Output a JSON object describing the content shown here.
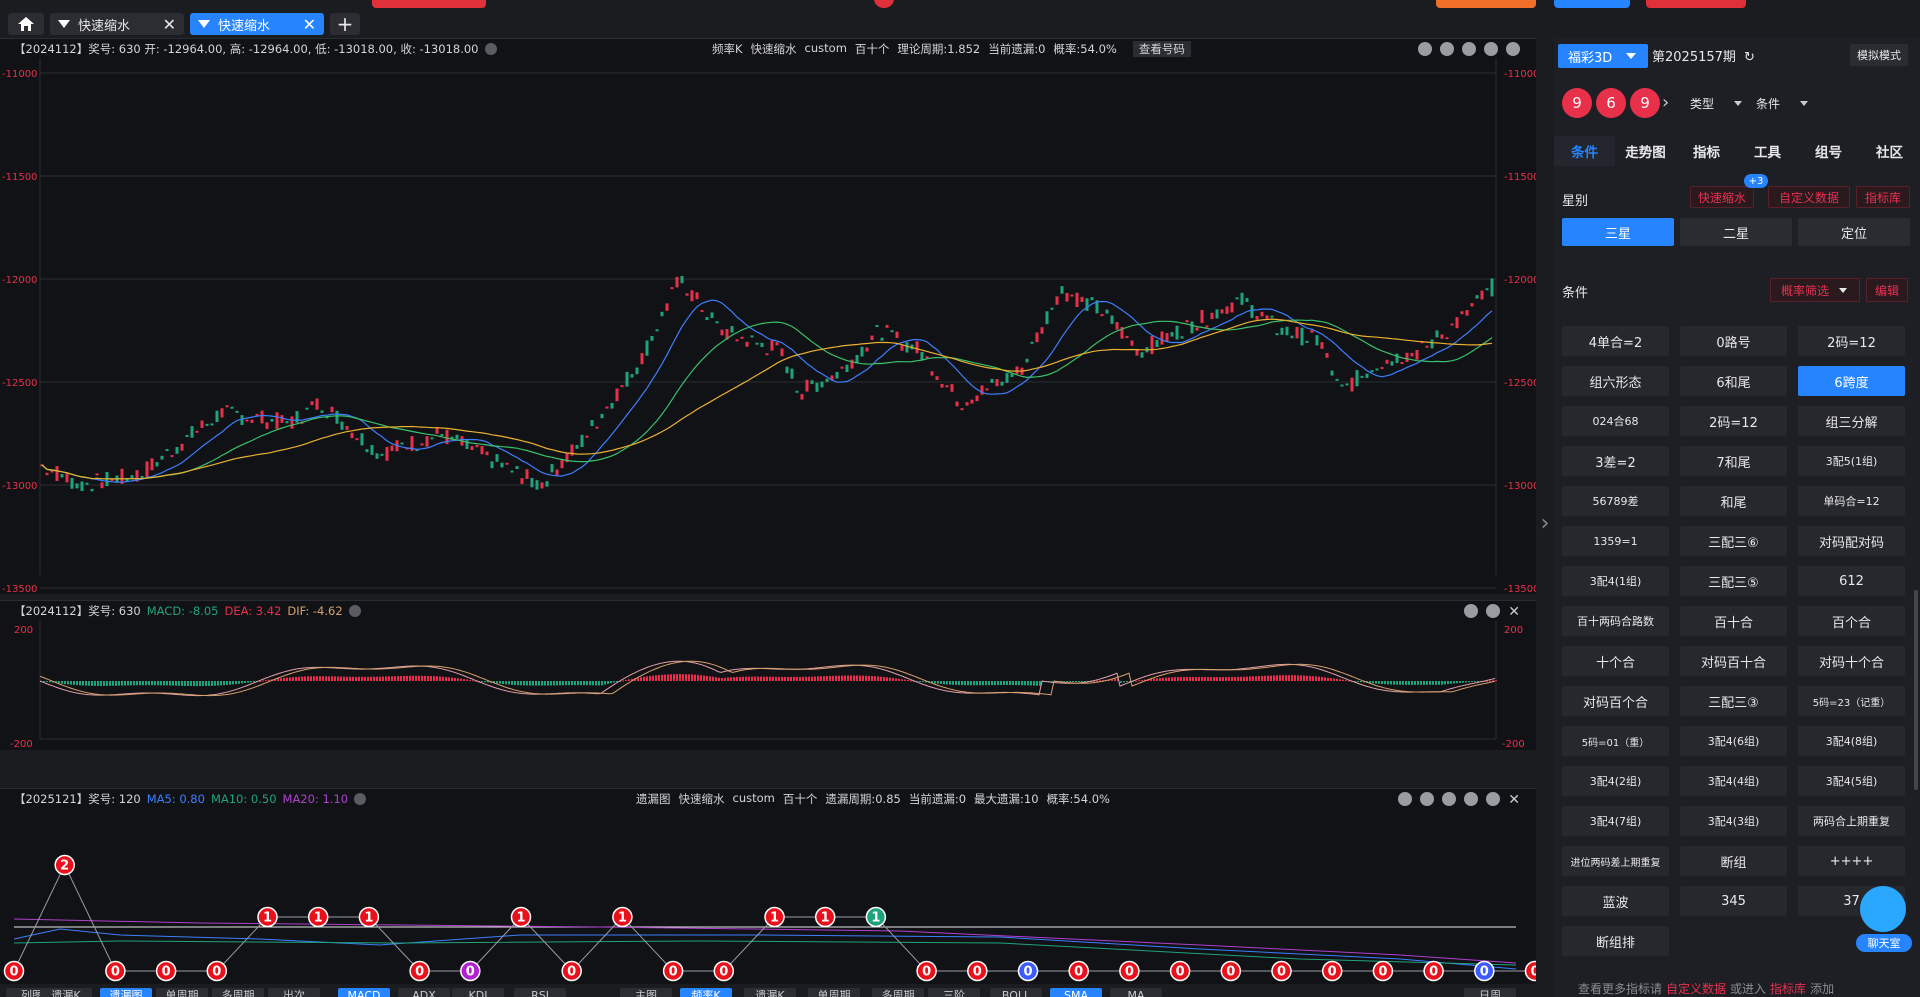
{
  "tabs": [
    {
      "label": "快速缩水",
      "active": false
    },
    {
      "label": "快速缩水",
      "active": true
    }
  ],
  "kline_panel": {
    "info": "【2024112】奖号: 630  开: -12964.00, 高: -12964.00, 低: -13018.00, 收: -13018.00",
    "center_items": [
      "频率K",
      "快速缩水",
      "custom",
      "百十个",
      "理论周期:1.852",
      "当前遗漏:0",
      "概率:54.0%"
    ],
    "check_label": "查看号码",
    "y_ticks": [
      "-11000",
      "-11500",
      "-12000",
      "-12500",
      "-13000",
      "-13500"
    ]
  },
  "macd_panel": {
    "prefix": "【2024112】奖号: 630",
    "macd": "MACD: -8.05",
    "dea": "DEA: 3.42",
    "dif": "DIF: -4.62",
    "y_ticks": [
      "200",
      "-200"
    ]
  },
  "miss_panel": {
    "prefix": "【2025121】奖号: 120",
    "ma5": "MA5: 0.80",
    "ma10": "MA10: 0.50",
    "ma20": "MA20: 1.10",
    "center_items": [
      "遗漏图",
      "快速缩水",
      "custom",
      "百十个",
      "遗漏周期:0.85",
      "当前遗漏:0",
      "最大遗漏:10",
      "概率:54.0%"
    ]
  },
  "right": {
    "lottery": "福彩3D",
    "issue": "第2025157期",
    "sim_mode": "模拟模式",
    "balls": [
      "9",
      "6",
      "9"
    ],
    "type_label": "类型",
    "cond_label": "条件",
    "nav": [
      "条件",
      "走势图",
      "指标",
      "工具",
      "组号",
      "社区"
    ],
    "star_label": "星别",
    "tags": [
      "快速缩水",
      "自定义数据",
      "指标库"
    ],
    "badge": "+3",
    "stars": [
      "三星",
      "二星",
      "定位"
    ],
    "cond_section": "条件",
    "filter": "概率筛选",
    "edit": "编辑",
    "grid": [
      "4单合=2",
      "0路号",
      "2码=12",
      "组六形态",
      "6和尾",
      "6跨度",
      "024合68",
      "2码=12",
      "组三分解",
      "3差=2",
      "7和尾",
      "3配5(1组)",
      "56789差",
      "和尾",
      "单码合=12",
      "1359=1",
      "三配三⑥",
      "对码配对码",
      "3配4(1组)",
      "三配三⑤",
      "612",
      "百十两码合路数",
      "百十合",
      "百个合",
      "十个合",
      "对码百十合",
      "对码十个合",
      "对码百个合",
      "三配三③",
      "5码=23（记重）",
      "5码=01（重）",
      "3配4(6组)",
      "3配4(8组)",
      "3配4(2组)",
      "3配4(4组)",
      "3配4(5组)",
      "3配4(7组)",
      "3配4(3组)",
      "两码合上期重复",
      "进位两码差上期重复",
      "断组",
      "++++",
      "蓝波",
      "345",
      "37",
      "断组排"
    ],
    "footer": [
      "查看更多指标请",
      "自定义数据",
      "或进入",
      "指标库",
      "添加"
    ],
    "chat": "聊天室"
  },
  "bottom_bar": [
    "列图",
    "遗漏K",
    "遗漏图",
    "单周期",
    "多周期",
    "出次",
    "MACD",
    "ADX",
    "KDJ",
    "RSI",
    "主图",
    "频率K",
    "遗漏K",
    "单周期",
    "多周期",
    "三阶",
    "BOLL",
    "SMA",
    "MA",
    "日周"
  ],
  "miss_chart": {
    "values": [
      "0",
      "2",
      "0",
      "0",
      "0",
      "1",
      "1",
      "1",
      "0",
      "0",
      "1",
      "0",
      "1",
      "0",
      "0",
      "1",
      "1",
      "1",
      "0",
      "0",
      "0",
      "0",
      "0",
      "0",
      "0",
      "0",
      "0",
      "0",
      "0",
      "0",
      "0"
    ]
  },
  "colors": {
    "accent": "#2684ff",
    "red": "#e8304a",
    "green": "#1fa37a"
  }
}
